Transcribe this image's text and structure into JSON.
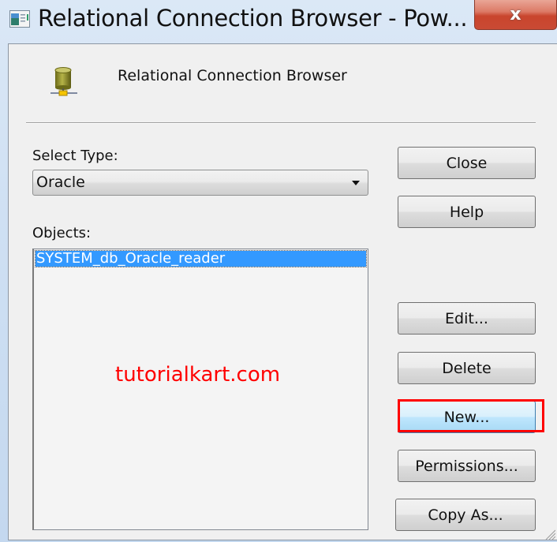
{
  "window": {
    "title": "Relational Connection Browser - Pow...",
    "close_label": "x"
  },
  "header": {
    "title": "Relational Connection Browser",
    "icon": "database-icon"
  },
  "form": {
    "select_type_label": "Select Type:",
    "select_type_value": "Oracle",
    "objects_label": "Objects:",
    "objects": [
      {
        "name": "SYSTEM_db_Oracle_reader",
        "selected": true
      }
    ]
  },
  "buttons": {
    "close": "Close",
    "help": "Help",
    "edit": "Edit...",
    "delete": "Delete",
    "new": "New...",
    "permissions": "Permissions...",
    "copy_as": "Copy As..."
  },
  "annotation": {
    "watermark": "tutorialkart.com",
    "highlight_color": "#ff0000",
    "highlighted_button": "new"
  },
  "colors": {
    "selection": "#3399ff",
    "watermark": "#ff0000"
  }
}
